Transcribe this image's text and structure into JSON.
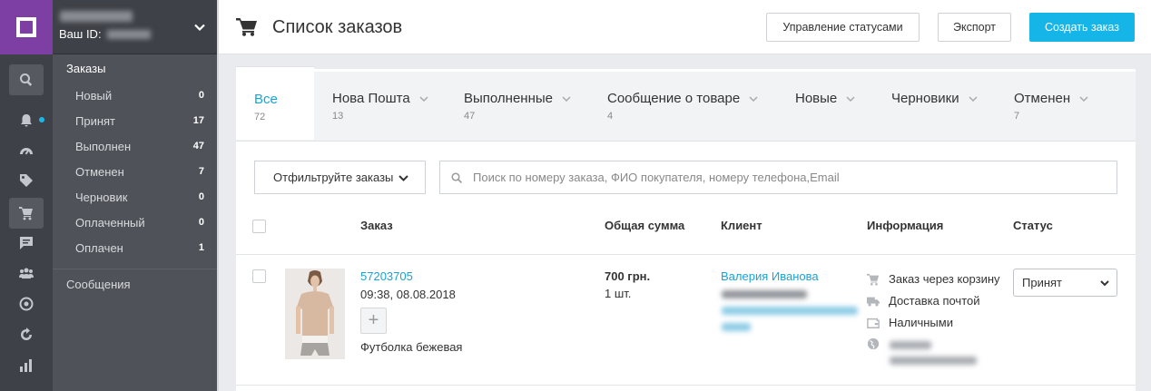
{
  "account": {
    "id_label": "Ваш ID:"
  },
  "sidebar": {
    "section_title": "Заказы",
    "items": [
      {
        "label": "Новый",
        "count": "0"
      },
      {
        "label": "Принят",
        "count": "17"
      },
      {
        "label": "Выполнен",
        "count": "47"
      },
      {
        "label": "Отменен",
        "count": "7"
      },
      {
        "label": "Черновик",
        "count": "0"
      },
      {
        "label": "Оплаченный",
        "count": "0"
      },
      {
        "label": "Оплачен",
        "count": "1"
      }
    ],
    "messages": "Сообщения"
  },
  "rail_icons": [
    "search-icon",
    "bell-icon",
    "dashboard-icon",
    "tag-icon",
    "cart-icon",
    "chat-icon",
    "users-icon",
    "target-icon",
    "refresh-icon",
    "stats-icon"
  ],
  "header": {
    "title": "Список заказов",
    "manage_statuses": "Управление статусами",
    "export": "Экспорт",
    "create_order": "Создать заказ"
  },
  "tabs": [
    {
      "label": "Все",
      "count": "72"
    },
    {
      "label": "Нова Пошта",
      "count": "13"
    },
    {
      "label": "Выполненные",
      "count": "47"
    },
    {
      "label": "Сообщение о товаре",
      "count": "4"
    },
    {
      "label": "Новые",
      "count": ""
    },
    {
      "label": "Черновики",
      "count": ""
    },
    {
      "label": "Отменен",
      "count": "7"
    }
  ],
  "filter": {
    "label": "Отфильтруйте заказы"
  },
  "search": {
    "placeholder": "Поиск по номеру заказа, ФИО покупателя, номеру телефона,Email"
  },
  "table": {
    "columns": {
      "order": "Заказ",
      "total": "Общая сумма",
      "client": "Клиент",
      "info": "Информация",
      "status": "Статус"
    },
    "row": {
      "order_number": "57203705",
      "datetime": "09:38, 08.08.2018",
      "product": "Футболка бежевая",
      "total": "700 грн.",
      "quantity": "1 шт.",
      "client_name": "Валерия Иванова",
      "info": [
        "Заказ через корзину",
        "Доставка почтой",
        "Наличными"
      ],
      "status": "Принят"
    }
  },
  "colors": {
    "accent": "#16b5e8",
    "brand": "#7e3fa5",
    "sidebar": "#4f5258",
    "rail": "#3e4147"
  }
}
